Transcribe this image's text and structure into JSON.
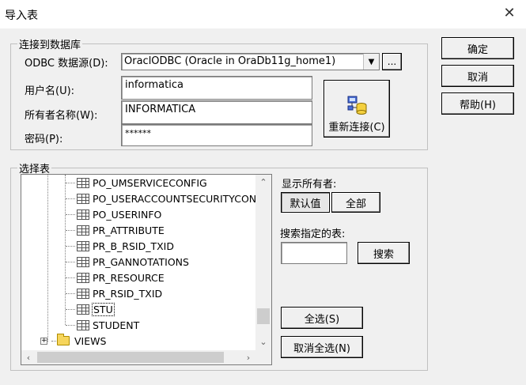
{
  "window": {
    "title": "导入表",
    "close_glyph": "✕"
  },
  "connect_group": {
    "legend": "连接到数据库",
    "odbc_label": "ODBC 数据源(D):",
    "odbc_value": "OraclODBC (Oracle in OraDb11g_home1)",
    "browse_label": "...",
    "user_label": "用户名(U):",
    "user_value": "informatica",
    "owner_label": "所有者名称(W):",
    "owner_value": "INFORMATICA",
    "password_label": "密码(P):",
    "password_value": "******",
    "reconnect_label": "重新连接(C)"
  },
  "side_buttons": {
    "ok": "确定",
    "cancel": "取消",
    "help": "帮助(H)"
  },
  "select_group": {
    "legend": "选择表",
    "show_owner_label": "显示所有者:",
    "default_btn": "默认值",
    "all_btn": "全部",
    "search_label": "搜索指定的表:",
    "search_value": "",
    "search_btn": "搜索",
    "select_all_btn": "全选(S)",
    "deselect_all_btn": "取消全选(N)"
  },
  "tree": {
    "items": [
      {
        "label": "PO_UMSERVICECONFIG"
      },
      {
        "label": "PO_USERACCOUNTSECURITYCON"
      },
      {
        "label": "PO_USERINFO"
      },
      {
        "label": "PR_ATTRIBUTE"
      },
      {
        "label": "PR_B_RSID_TXID"
      },
      {
        "label": "PR_GANNOTATIONS"
      },
      {
        "label": "PR_RESOURCE"
      },
      {
        "label": "PR_RSID_TXID"
      },
      {
        "label": "STU"
      },
      {
        "label": "STUDENT"
      }
    ],
    "folder": {
      "label": "VIEWS",
      "expander": "+"
    },
    "selected_index": 8,
    "vscroll_position": 0.92
  }
}
